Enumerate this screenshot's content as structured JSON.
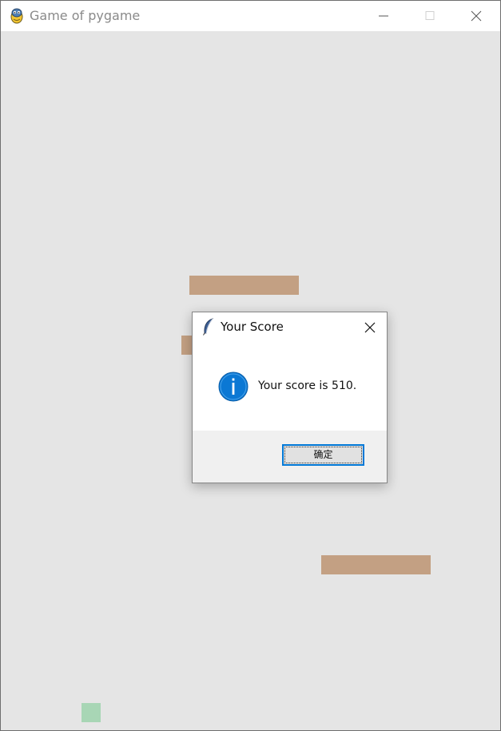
{
  "window": {
    "title": "Game of pygame",
    "app_icon": "pygame-snake-icon",
    "controls": {
      "minimize_icon": "minimize-icon",
      "maximize_icon": "maximize-icon",
      "close_icon": "close-icon"
    }
  },
  "game": {
    "background_color": "#e5e5e5",
    "platform_color": "#c3a083",
    "player_color": "#a8d6b5"
  },
  "dialog": {
    "title": "Your Score",
    "title_icon": "feather-icon",
    "close_icon": "close-icon",
    "message_icon": "info-icon",
    "message": "Your score is 510.",
    "ok_label": "确定",
    "accent_color": "#0078d7"
  }
}
